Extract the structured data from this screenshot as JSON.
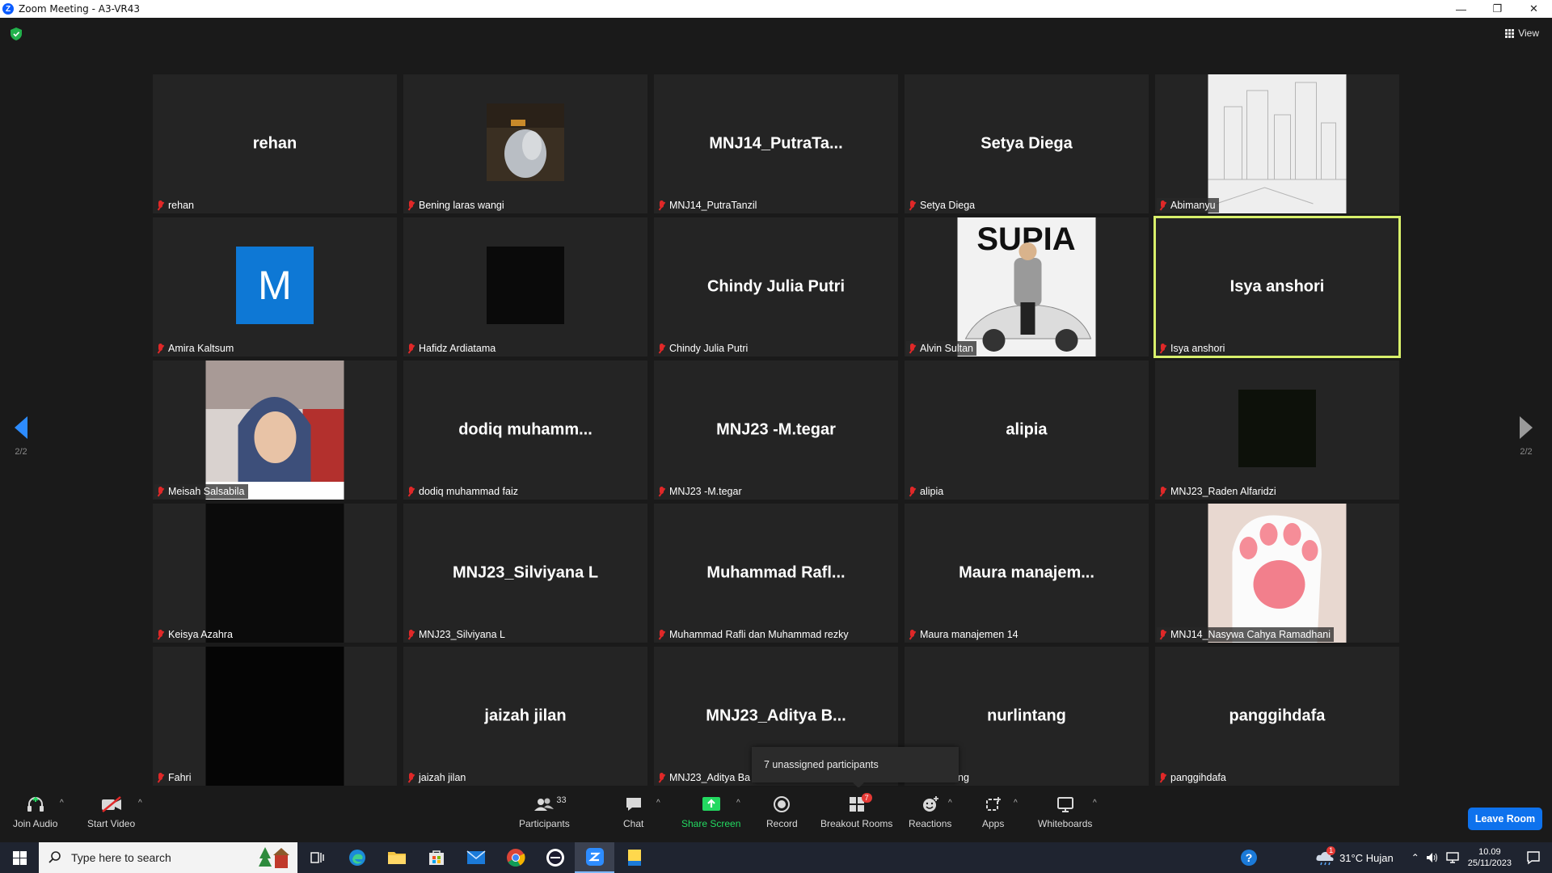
{
  "window": {
    "title": "Zoom Meeting - A3-VR43"
  },
  "header": {
    "view_label": "View"
  },
  "pager": {
    "left": "2/2",
    "right": "2/2"
  },
  "tiles": [
    {
      "big": "rehan",
      "name": "rehan"
    },
    {
      "big": "",
      "name": "Bening laras wangi"
    },
    {
      "big": "MNJ14_PutraTa...",
      "name": "MNJ14_PutraTanzil"
    },
    {
      "big": "Setya Diega",
      "name": "Setya Diega"
    },
    {
      "big": "",
      "name": "Abimanyu"
    },
    {
      "big": "",
      "name": "Amira Kaltsum",
      "avatar": "M"
    },
    {
      "big": "",
      "name": "Hafidz Ardiatama"
    },
    {
      "big": "Chindy Julia Putri",
      "name": "Chindy Julia Putri"
    },
    {
      "big": "",
      "name": "Alvin Sultan",
      "pic_text": "SUPIA"
    },
    {
      "big": "Isya anshori",
      "name": "Isya anshori"
    },
    {
      "big": "",
      "name": "Meisah Salsabila"
    },
    {
      "big": "dodiq  muhamm...",
      "name": "dodiq muhammad faiz"
    },
    {
      "big": "MNJ23 -M.tegar",
      "name": "MNJ23 -M.tegar"
    },
    {
      "big": "alipia",
      "name": "alipia"
    },
    {
      "big": "",
      "name": "MNJ23_Raden Alfaridzi"
    },
    {
      "big": "",
      "name": "Keisya Azahra"
    },
    {
      "big": "MNJ23_Silviyana L",
      "name": "MNJ23_Silviyana L"
    },
    {
      "big": "Muhammad  Rafl...",
      "name": "Muhammad Rafli dan Muhammad rezky"
    },
    {
      "big": "Maura  manajem...",
      "name": "Maura manajemen 14"
    },
    {
      "big": "",
      "name": "MNJ14_Nasywa Cahya Ramadhani"
    },
    {
      "big": "",
      "name": "Fahri"
    },
    {
      "big": "jaizah jilan",
      "name": "jaizah jilan"
    },
    {
      "big": "MNJ23_Aditya  B...",
      "name": "MNJ23_Aditya Ba"
    },
    {
      "big": "nurlintang",
      "name": "ng"
    },
    {
      "big": "panggihdafa",
      "name": "panggihdafa"
    }
  ],
  "tooltip": {
    "text": "7 unassigned participants"
  },
  "toolbar": {
    "join_audio": "Join Audio",
    "start_video": "Start Video",
    "participants": "Participants",
    "participants_count": "33",
    "chat": "Chat",
    "share_screen": "Share Screen",
    "record": "Record",
    "breakout_rooms": "Breakout Rooms",
    "breakout_badge": "7",
    "reactions": "Reactions",
    "apps": "Apps",
    "whiteboards": "Whiteboards",
    "leave": "Leave Room"
  },
  "taskbar": {
    "search_placeholder": "Type here to search",
    "weather": "31°C  Hujan",
    "weather_badge": "1",
    "time": "10.09",
    "date": "25/11/2023"
  },
  "colors": {
    "accent_blue": "#0e72ed",
    "mute_red": "#e02828",
    "active_speaker": "#d8f06b",
    "share_green": "#23d961"
  }
}
